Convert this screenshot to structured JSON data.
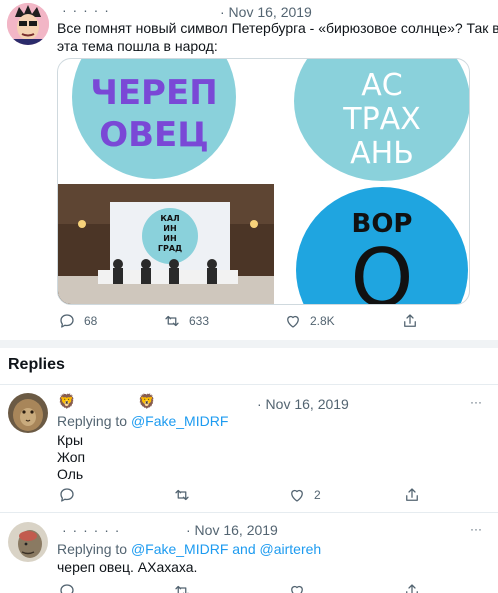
{
  "tweet": {
    "date": "· Nov 16, 2019",
    "text_line1": "Все помнят новый символ Петербурга - «бирюзовое солнце»? Так вот,",
    "text_line2": "эта тема пошла в народ:",
    "images": {
      "img1_words": [
        "ЧЕРЕП",
        "ОВЕЦ"
      ],
      "img2_words": [
        "АС",
        "ТРАХ",
        "АНЬ"
      ],
      "img3_words": [
        "КАЛ",
        "ИН",
        "ИН",
        "ГРАД"
      ],
      "img4_words": [
        "ВОР",
        "О"
      ]
    },
    "actions": {
      "replies": "68",
      "retweets": "633",
      "likes": "2.8K"
    }
  },
  "replies_section": {
    "heading": "Replies"
  },
  "reply1": {
    "emoji_left": "🦁",
    "emoji_right": "🦁",
    "date": "· Nov 16, 2019",
    "replying_prefix": "Replying to",
    "replying_to": "@Fake_MIDRF",
    "lines": [
      "Кры",
      "Жоп",
      "Оль"
    ],
    "likes": "2"
  },
  "reply2": {
    "date": "· Nov 16, 2019",
    "replying_prefix": "Replying to",
    "replying_to": "@Fake_MIDRF and @airtereh",
    "text": "череп овец. АХахаха."
  },
  "colors": {
    "link": "#1d9bf0",
    "circle_light": "#8ad1db",
    "circle_dark": "#1fa5e0",
    "purple": "#7a48d6"
  }
}
